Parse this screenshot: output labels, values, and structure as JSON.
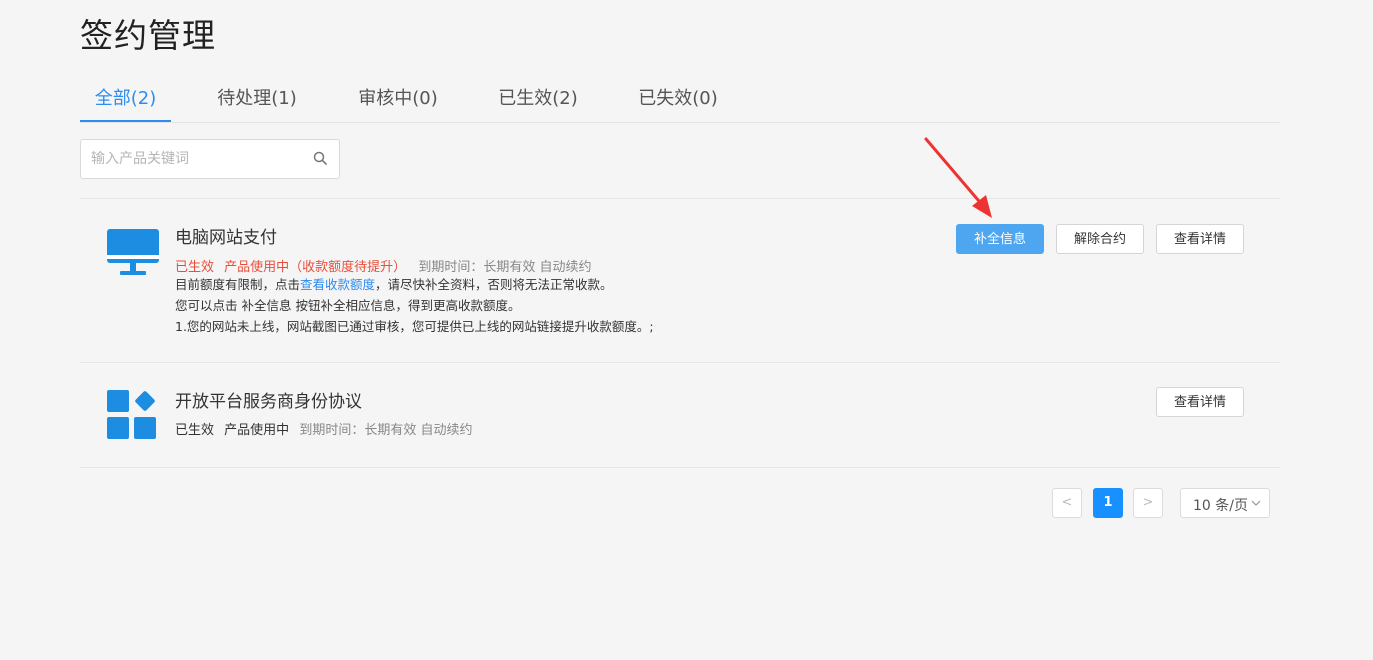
{
  "header": {
    "title": "签约管理"
  },
  "tabs": [
    {
      "label": "全部(2)",
      "active": true
    },
    {
      "label": "待处理(1)",
      "active": false
    },
    {
      "label": "审核中(0)",
      "active": false
    },
    {
      "label": "已生效(2)",
      "active": false
    },
    {
      "label": "已失效(0)",
      "active": false
    }
  ],
  "search": {
    "placeholder": "输入产品关键词",
    "value": "",
    "icon": "search-icon"
  },
  "products": [
    {
      "icon": "monitor-icon",
      "name": "电脑网站支付",
      "status": "已生效",
      "usage": "产品使用中（收款额度待提升）",
      "expiry": "到期时间：长期有效 自动续约",
      "desc_line1_prefix": "目前额度有限制，点击",
      "desc_line1_link": "查看收款额度",
      "desc_line1_suffix": "，请尽快补全资料，否则将无法正常收款。",
      "desc_line2": "您可以点击 补全信息 按钮补全相应信息，得到更高收款额度。",
      "desc_line3": "1.您的网站未上线，网站截图已通过审核，您可提供已上线的网站链接提升收款额度。;",
      "buttons": {
        "complete": "补全信息",
        "terminate": "解除合约",
        "details": "查看详情"
      }
    },
    {
      "icon": "app-grid-icon",
      "name": "开放平台服务商身份协议",
      "status": "已生效",
      "usage": "产品使用中",
      "expiry": "到期时间：长期有效 自动续约",
      "buttons": {
        "details": "查看详情"
      }
    }
  ],
  "pagination": {
    "prev": "<",
    "current": "1",
    "next": ">",
    "page_size": "10 条/页"
  },
  "colors": {
    "accent": "#2d8cf0",
    "primary_button": "#4fa6f0",
    "status_red": "#e94e3c",
    "icon_blue": "#1c8de0",
    "annotation_arrow": "#ee3333"
  }
}
